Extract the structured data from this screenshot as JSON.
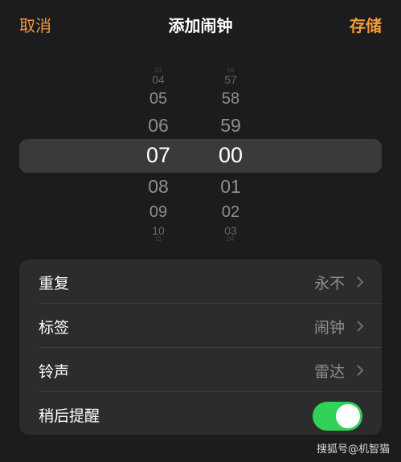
{
  "nav": {
    "cancel_label": "取消",
    "title": "添加闹钟",
    "save_label": "存储"
  },
  "picker": {
    "hours": [
      "03",
      "04",
      "05",
      "06",
      "07",
      "08",
      "09",
      "10",
      "11"
    ],
    "minutes": [
      "56",
      "57",
      "58",
      "59",
      "00",
      "01",
      "02",
      "03",
      "04"
    ],
    "selected_hour": "07",
    "selected_minute": "00"
  },
  "settings": {
    "repeat": {
      "label": "重复",
      "value": "永不"
    },
    "tag": {
      "label": "标签",
      "value": "闹钟"
    },
    "sound": {
      "label": "铃声",
      "value": "雷达"
    },
    "snooze": {
      "label": "稍后提醒",
      "enabled": true
    }
  },
  "colors": {
    "accent": "#f19a37",
    "toggle_on": "#32d158",
    "background": "#1c1c1e",
    "group_bg": "#2c2c2e",
    "secondary_text": "#8e8e93"
  },
  "watermark": "搜狐号@机智猫"
}
